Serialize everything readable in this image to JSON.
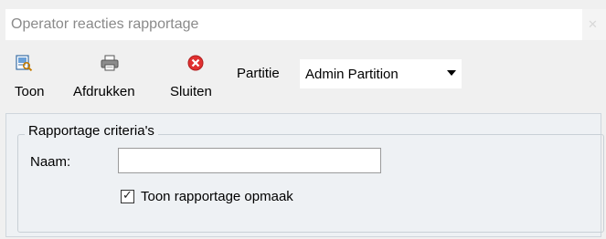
{
  "window": {
    "title": "Operator reacties rapportage",
    "close_glyph": "✕"
  },
  "toolbar": {
    "buttons": [
      {
        "label": "Toon",
        "icon": "report-view-icon"
      },
      {
        "label": "Afdrukken",
        "icon": "printer-icon"
      },
      {
        "label": "Sluiten",
        "icon": "close-circle-icon",
        "color": "#e03030"
      }
    ],
    "partition": {
      "label": "Partitie",
      "selected": "Admin Partition"
    }
  },
  "criteria": {
    "group_title": "Rapportage criteria's",
    "name_label": "Naam:",
    "name_value": "",
    "show_layout_label": "Toon rapportage opmaak",
    "show_layout_checked": true
  },
  "colors": {
    "panel_bg": "#eef1f4",
    "window_bg": "#f0f0f0"
  }
}
